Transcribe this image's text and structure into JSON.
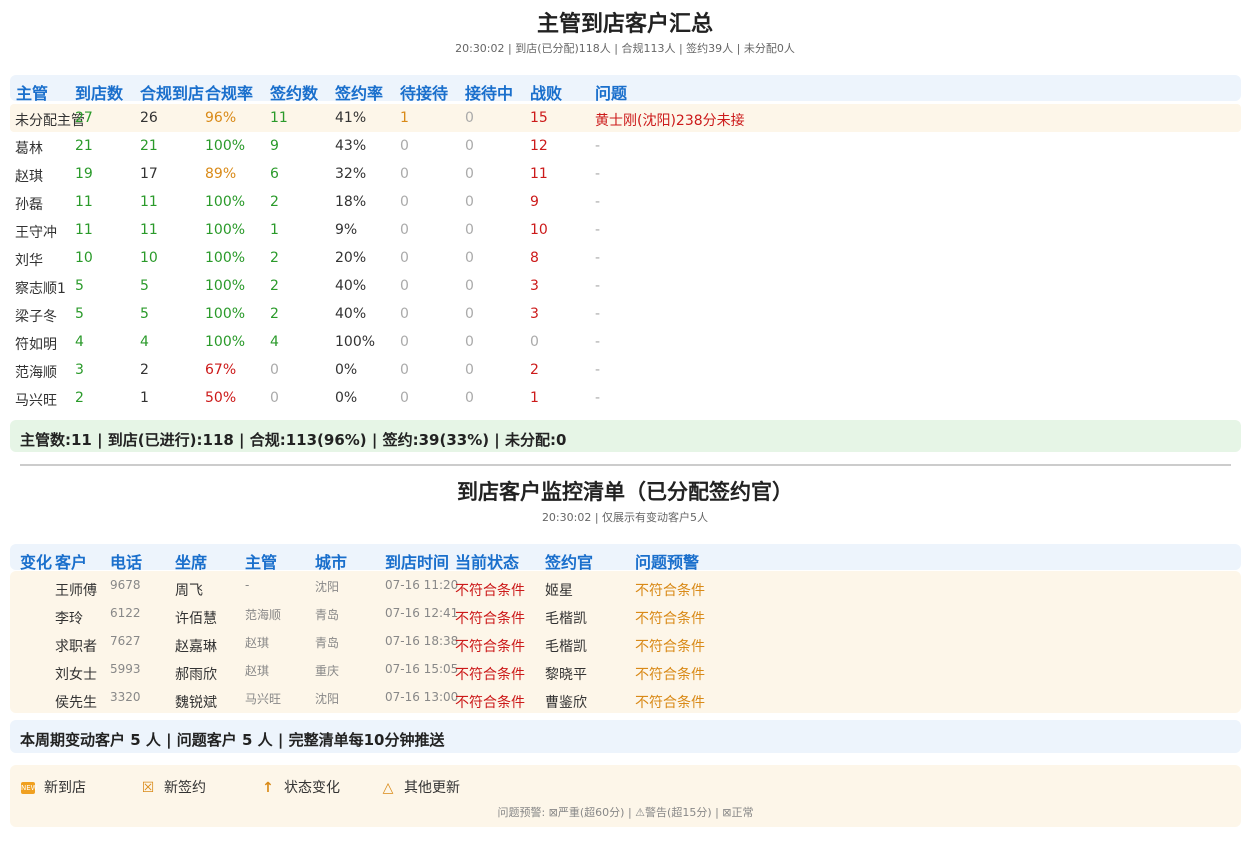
{
  "summary": {
    "title": "主管到店客户汇总",
    "subtitle": "20:30:02 | 到店(已分配)118人 | 合规113人 | 签约39人 | 未分配0人",
    "headers": [
      "主管",
      "到店数",
      "合规到店",
      "合规率",
      "签约数",
      "签约率",
      "待接待",
      "接待中",
      "战败",
      "问题"
    ],
    "rows": [
      {
        "name": "未分配主管",
        "arrive": "27",
        "compliant": "26",
        "rate": "96%",
        "signed": "11",
        "sign_rate": "41%",
        "waiting": "1",
        "serving": "0",
        "lost": "15",
        "issue": "黄士刚(沈阳)238分未接"
      },
      {
        "name": "葛林",
        "arrive": "21",
        "compliant": "21",
        "rate": "100%",
        "signed": "9",
        "sign_rate": "43%",
        "waiting": "0",
        "serving": "0",
        "lost": "12",
        "issue": "-"
      },
      {
        "name": "赵琪",
        "arrive": "19",
        "compliant": "17",
        "rate": "89%",
        "signed": "6",
        "sign_rate": "32%",
        "waiting": "0",
        "serving": "0",
        "lost": "11",
        "issue": "-"
      },
      {
        "name": "孙磊",
        "arrive": "11",
        "compliant": "11",
        "rate": "100%",
        "signed": "2",
        "sign_rate": "18%",
        "waiting": "0",
        "serving": "0",
        "lost": "9",
        "issue": "-"
      },
      {
        "name": "王守冲",
        "arrive": "11",
        "compliant": "11",
        "rate": "100%",
        "signed": "1",
        "sign_rate": "9%",
        "waiting": "0",
        "serving": "0",
        "lost": "10",
        "issue": "-"
      },
      {
        "name": "刘华",
        "arrive": "10",
        "compliant": "10",
        "rate": "100%",
        "signed": "2",
        "sign_rate": "20%",
        "waiting": "0",
        "serving": "0",
        "lost": "8",
        "issue": "-"
      },
      {
        "name": "察志顺1",
        "arrive": "5",
        "compliant": "5",
        "rate": "100%",
        "signed": "2",
        "sign_rate": "40%",
        "waiting": "0",
        "serving": "0",
        "lost": "3",
        "issue": "-"
      },
      {
        "name": "梁子冬",
        "arrive": "5",
        "compliant": "5",
        "rate": "100%",
        "signed": "2",
        "sign_rate": "40%",
        "waiting": "0",
        "serving": "0",
        "lost": "3",
        "issue": "-"
      },
      {
        "name": "符如明",
        "arrive": "4",
        "compliant": "4",
        "rate": "100%",
        "signed": "4",
        "sign_rate": "100%",
        "waiting": "0",
        "serving": "0",
        "lost": "0",
        "issue": "-"
      },
      {
        "name": "范海顺",
        "arrive": "3",
        "compliant": "2",
        "rate": "67%",
        "signed": "0",
        "sign_rate": "0%",
        "waiting": "0",
        "serving": "0",
        "lost": "2",
        "issue": "-"
      },
      {
        "name": "马兴旺",
        "arrive": "2",
        "compliant": "1",
        "rate": "50%",
        "signed": "0",
        "sign_rate": "0%",
        "waiting": "0",
        "serving": "0",
        "lost": "1",
        "issue": "-"
      }
    ],
    "footer": "主管数:11 | 到店(已进行):118 | 合规:113(96%) | 签约:39(33%) | 未分配:0"
  },
  "monitor": {
    "title": "到店客户监控清单（已分配签约官）",
    "subtitle": "20:30:02 | 仅展示有变动客户5人",
    "headers": [
      "变化",
      "客户",
      "电话",
      "坐席",
      "主管",
      "城市",
      "到店时间",
      "当前状态",
      "签约官",
      "问题预警"
    ],
    "rows": [
      {
        "change": "",
        "customer": "王师傅",
        "phone": "9678",
        "agent": "周飞",
        "manager": "-",
        "city": "沈阳",
        "time": "07-16 11:20",
        "status": "不符合条件",
        "officer": "姬星",
        "warning": "不符合条件"
      },
      {
        "change": "",
        "customer": "李玲",
        "phone": "6122",
        "agent": "许佰慧",
        "manager": "范海顺",
        "city": "青岛",
        "time": "07-16 12:41",
        "status": "不符合条件",
        "officer": "毛楷凯",
        "warning": "不符合条件"
      },
      {
        "change": "",
        "customer": "求职者",
        "phone": "7627",
        "agent": "赵嘉琳",
        "manager": "赵琪",
        "city": "青岛",
        "time": "07-16 18:38",
        "status": "不符合条件",
        "officer": "毛楷凯",
        "warning": "不符合条件"
      },
      {
        "change": "",
        "customer": "刘女士",
        "phone": "5993",
        "agent": "郝雨欣",
        "manager": "赵琪",
        "city": "重庆",
        "time": "07-16 15:05",
        "status": "不符合条件",
        "officer": "黎晓平",
        "warning": "不符合条件"
      },
      {
        "change": "",
        "customer": "侯先生",
        "phone": "3320",
        "agent": "魏锐斌",
        "manager": "马兴旺",
        "city": "沈阳",
        "time": "07-16 13:00",
        "status": "不符合条件",
        "officer": "曹鉴欣",
        "warning": "不符合条件"
      }
    ],
    "footer": "本周期变动客户 5 人 | 问题客户 5 人 | 完整清单每10分钟推送"
  },
  "legend": {
    "items": [
      {
        "icon": "new-badge-icon",
        "label": "新到店"
      },
      {
        "icon": "box-x-icon",
        "label": "新签约"
      },
      {
        "icon": "up-arrow-icon",
        "label": "状态变化"
      },
      {
        "icon": "triangle-icon",
        "label": "其他更新"
      }
    ],
    "note": "问题预警: ⊠严重(超60分) | ⚠警告(超15分) | ⊠正常"
  },
  "colors": {
    "header_text": "#1a6fcc",
    "green": "#2a9a2a",
    "orange": "#d98a18",
    "red": "#cc1a1a",
    "highlight_row": "#fdf6e9",
    "header_bg": "#edf4fc",
    "summary_bg": "#e6f5e6"
  }
}
